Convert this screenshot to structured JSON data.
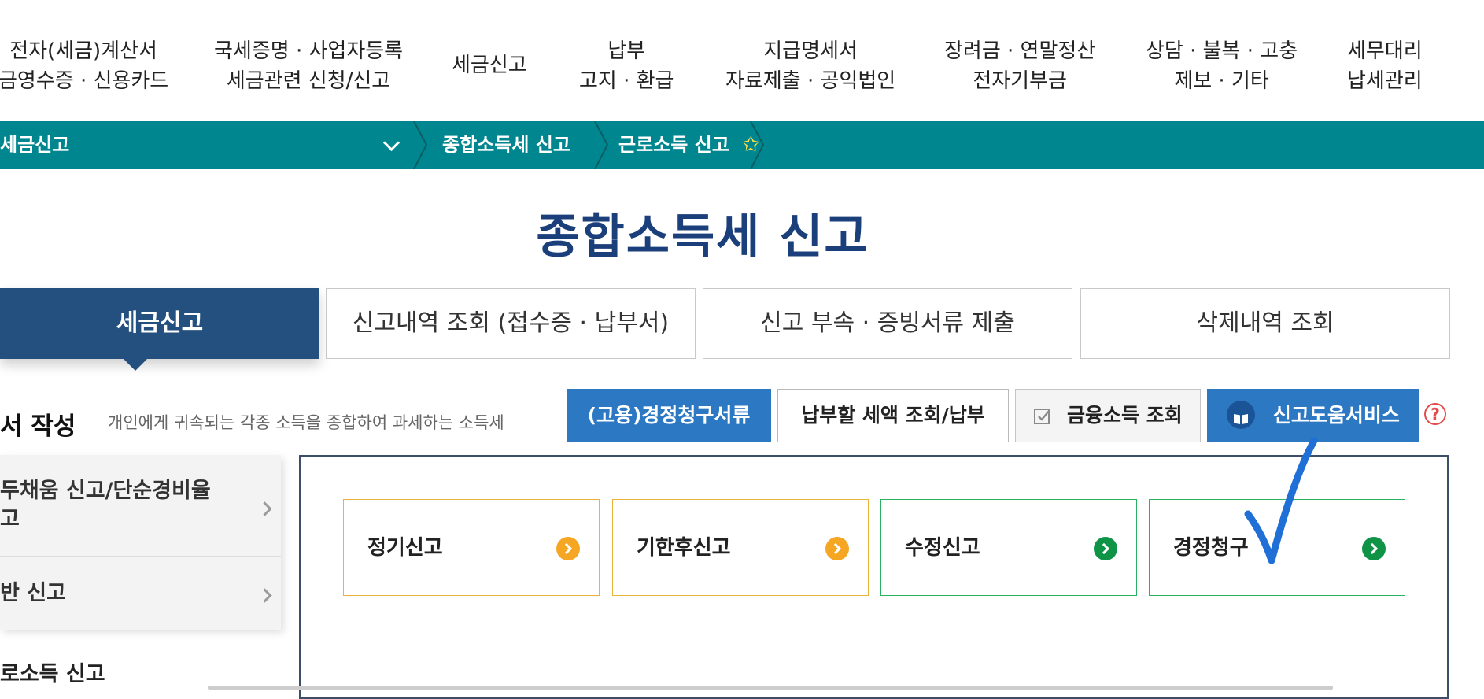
{
  "gnb": {
    "items": [
      {
        "line1": "전자(세금)계산서",
        "line2": "금영수증 · 신용카드"
      },
      {
        "line1": "국세증명 · 사업자등록",
        "line2": "세금관련 신청/신고"
      },
      {
        "line1": "세금신고"
      },
      {
        "line1": "납부",
        "line2": "고지 · 환급"
      },
      {
        "line1": "지급명세서",
        "line2": "자료제출 · 공익법인"
      },
      {
        "line1": "장려금 · 연말정산",
        "line2": "전자기부금"
      },
      {
        "line1": "상담 · 불복 · 고충",
        "line2": "제보 · 기타"
      },
      {
        "line1": "세무대리",
        "line2": "납세관리"
      }
    ]
  },
  "breadcrumb": {
    "select_label": "세금신고",
    "crumbs": [
      "종합소득세 신고",
      "근로소득 신고"
    ]
  },
  "page": {
    "title": "종합소득세 신고"
  },
  "tabs": [
    {
      "label": "세금신고"
    },
    {
      "label": "신고내역 조회 (접수증 · 납부서)"
    },
    {
      "label": "신고 부속 · 증빙서류 제출"
    },
    {
      "label": "삭제내역 조회"
    }
  ],
  "section": {
    "title": "서 작성",
    "description": "개인에게 귀속되는 각종 소득을 종합하여 과세하는 소득세"
  },
  "actions": [
    {
      "label": "(고용)경정청구서류"
    },
    {
      "label": "납부할 세액 조회/납부"
    },
    {
      "label": "금융소득 조회"
    },
    {
      "label": "신고도움서비스"
    }
  ],
  "help": {
    "label": "?"
  },
  "lnb": {
    "items": [
      {
        "line1": "두채움 신고/단순경비율",
        "line2": "고"
      },
      {
        "line1": "반 신고"
      }
    ]
  },
  "sub_section": {
    "title": "로소득 신고"
  },
  "cards": [
    {
      "label": "정기신고",
      "variant": "orange"
    },
    {
      "label": "기한후신고",
      "variant": "orange"
    },
    {
      "label": "수정신고",
      "variant": "green"
    },
    {
      "label": "경정청구",
      "variant": "green"
    }
  ],
  "colors": {
    "teal_bar": "#00868f",
    "navy": "#24507f",
    "title_blue": "#1b3f7a",
    "action_blue": "#2c78c3",
    "orange": "#f5a623",
    "green": "#0f9447",
    "annotation": "#1f6fd6"
  }
}
